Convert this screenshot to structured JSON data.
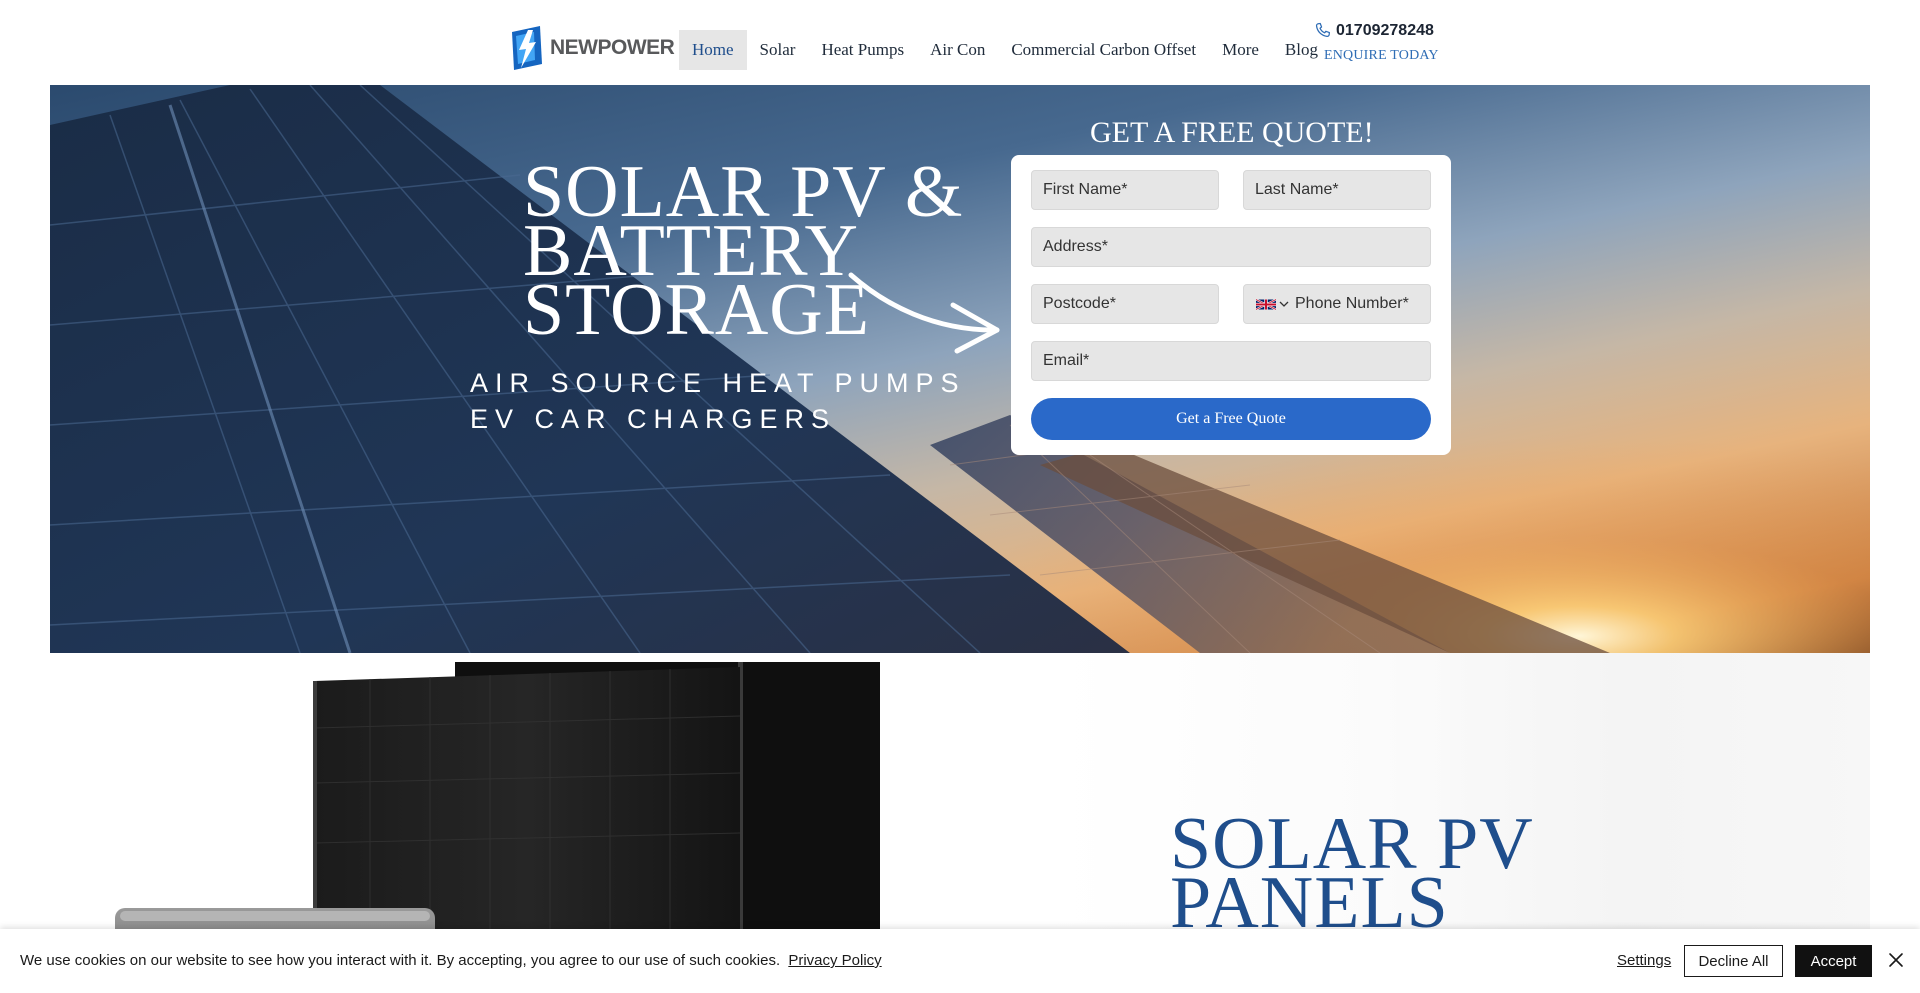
{
  "header": {
    "logo_text": "NEWPOWER",
    "nav": [
      {
        "label": "Home",
        "active": true
      },
      {
        "label": "Solar"
      },
      {
        "label": "Heat Pumps"
      },
      {
        "label": "Air Con"
      },
      {
        "label": "Commercial Carbon Offset"
      },
      {
        "label": "More"
      },
      {
        "label": "Blog"
      }
    ],
    "phone": "01709278248",
    "enquire": "ENQUIRE TODAY"
  },
  "hero": {
    "title_lines": [
      "SOLAR PV &",
      "BATTERY",
      "STORAGE"
    ],
    "subtitle_lines": [
      "AIR SOURCE HEAT PUMPS",
      "EV CAR CHARGERS"
    ],
    "quote_heading": "GET A FREE QUOTE!"
  },
  "form": {
    "first_name_placeholder": "First Name*",
    "last_name_placeholder": "Last Name*",
    "address_placeholder": "Address*",
    "postcode_placeholder": "Postcode*",
    "phone_placeholder": "Phone Number*",
    "email_placeholder": "Email*",
    "submit_label": "Get a Free Quote"
  },
  "section2": {
    "title_lines": [
      "SOLAR PV",
      "PANELS"
    ]
  },
  "cookie": {
    "text": "We use cookies on our website to see how you interact with it. By accepting, you agree to our use of such cookies.",
    "privacy_link": "Privacy Policy",
    "settings_label": "Settings",
    "decline_label": "Decline All",
    "accept_label": "Accept"
  },
  "colors": {
    "brand_blue": "#1f4e8c",
    "button_blue": "#2a69c9",
    "link_blue": "#2f6db5"
  },
  "icons": [
    "logo-mark-icon",
    "phone-icon",
    "arrow-icon",
    "uk-flag-icon",
    "chevron-down-icon",
    "close-icon"
  ]
}
